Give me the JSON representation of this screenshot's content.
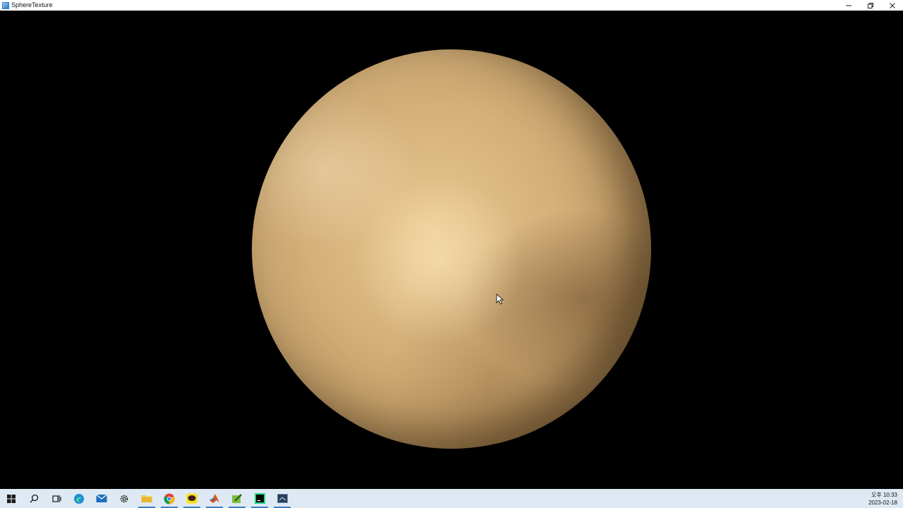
{
  "window": {
    "title": "SphereTexture",
    "controls": {
      "minimize_icon": "minimize-icon",
      "restore_icon": "restore-icon",
      "close_icon": "close-icon"
    }
  },
  "scene": {
    "background_color": "#000000",
    "object": "textured-sphere",
    "planet_base_color": "#d4b07a"
  },
  "taskbar": {
    "apps": [
      {
        "name": "start-icon"
      },
      {
        "name": "search-icon"
      },
      {
        "name": "task-view-icon"
      },
      {
        "name": "edge-icon"
      },
      {
        "name": "mail-icon"
      },
      {
        "name": "settings-icon"
      },
      {
        "name": "file-explorer-icon"
      },
      {
        "name": "chrome-icon"
      },
      {
        "name": "kakaotalk-icon"
      },
      {
        "name": "matlab-icon"
      },
      {
        "name": "app-icon"
      },
      {
        "name": "pycharm-icon"
      },
      {
        "name": "spheretexture-app-icon"
      }
    ],
    "clock": {
      "time": "오후 10:33",
      "date": "2023-02-18"
    }
  }
}
